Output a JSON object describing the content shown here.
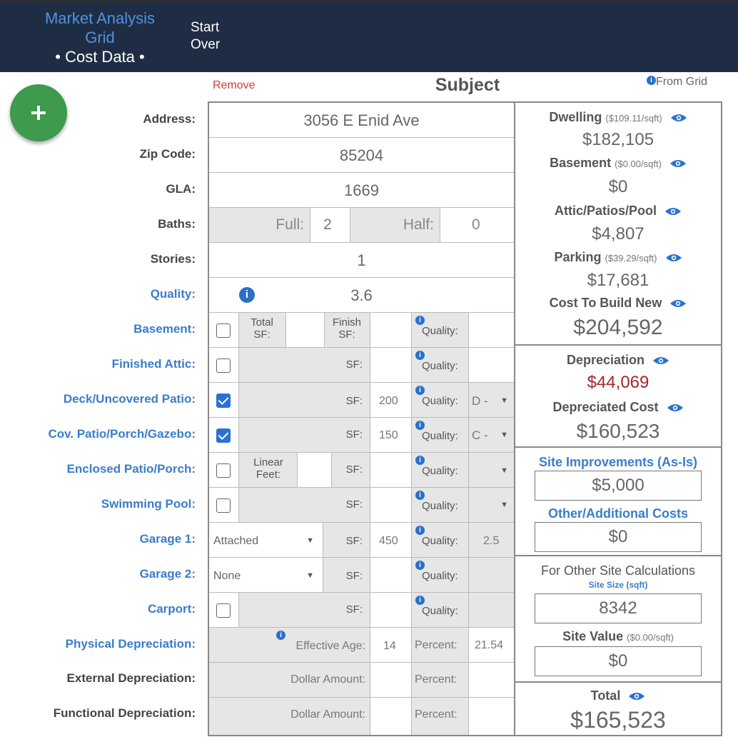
{
  "nav": {
    "market_analysis": "Market Analysis Grid",
    "cost_data": "• Cost Data •",
    "start_over": "Start Over"
  },
  "header": {
    "remove": "Remove",
    "subject": "Subject",
    "from_grid": "From Grid"
  },
  "labels": {
    "address": "Address:",
    "zip": "Zip Code:",
    "gla": "GLA:",
    "baths": "Baths:",
    "stories": "Stories:",
    "quality": "Quality:",
    "basement": "Basement:",
    "finished_attic": "Finished Attic:",
    "deck": "Deck/Uncovered Patio:",
    "cov_patio": "Cov. Patio/Porch/Gazebo:",
    "enclosed_patio": "Enclosed Patio/Porch:",
    "pool": "Swimming Pool:",
    "garage1": "Garage 1:",
    "garage2": "Garage 2:",
    "carport": "Carport:",
    "physical_dep": "Physical Depreciation:",
    "external_dep": "External Depreciation:",
    "functional_dep": "Functional Depreciation:"
  },
  "values": {
    "address": "3056 E Enid Ave",
    "zip": "85204",
    "gla": "1669",
    "baths_full_label": "Full:",
    "baths_full": "2",
    "baths_half_label": "Half:",
    "baths_half": "0",
    "stories": "1",
    "quality": "3.6",
    "total_sf": "Total SF:",
    "finish_sf": "Finish SF:",
    "sf": "SF:",
    "quality_label": "Quality:",
    "linear_feet": "Linear Feet:",
    "deck_sf": "200",
    "deck_quality": "D -",
    "cov_sf": "150",
    "cov_quality": "C -",
    "garage1_type": "Attached",
    "garage1_sf": "450",
    "garage1_quality": "2.5",
    "garage2_type": "None",
    "effective_age_label": "Effective Age:",
    "effective_age": "14",
    "percent_label": "Percent:",
    "physical_percent": "21.54",
    "dollar_amount_label": "Dollar Amount:"
  },
  "checkboxes": {
    "basement": false,
    "finished_attic": false,
    "deck": true,
    "cov_patio": true,
    "enclosed_patio": false,
    "pool": false,
    "carport": false
  },
  "panel": {
    "dwelling_title": "Dwelling",
    "dwelling_rate": "($109.11/sqft)",
    "dwelling_value": "$182,105",
    "basement_title": "Basement",
    "basement_rate": "($0.00/sqft)",
    "basement_value": "$0",
    "attic_title": "Attic/Patios/Pool",
    "attic_value": "$4,807",
    "parking_title": "Parking",
    "parking_rate": "($39.29/sqft)",
    "parking_value": "$17,681",
    "cost_new_title": "Cost To Build New",
    "cost_new_value": "$204,592",
    "depreciation_title": "Depreciation",
    "depreciation_value": "$44,069",
    "depreciated_cost_title": "Depreciated Cost",
    "depreciated_cost_value": "$160,523",
    "site_improvements_title": "Site Improvements (As-Is)",
    "site_improvements_value": "$5,000",
    "other_costs_title": "Other/Additional Costs",
    "other_costs_value": "$0",
    "other_site_title": "For Other Site Calculations",
    "site_size_title": "Site Size (sqft)",
    "site_size_value": "8342",
    "site_value_title": "Site Value",
    "site_value_rate": "($0.00/sqft)",
    "site_value_value": "$0",
    "total_title": "Total",
    "total_value": "$165,523"
  },
  "colors": {
    "header_bg": "#1f2d44",
    "accent_blue": "#3a7dc9",
    "add_green": "#3e9a4c",
    "remove_red": "#c6403a",
    "depreciation_red": "#a3282c"
  }
}
